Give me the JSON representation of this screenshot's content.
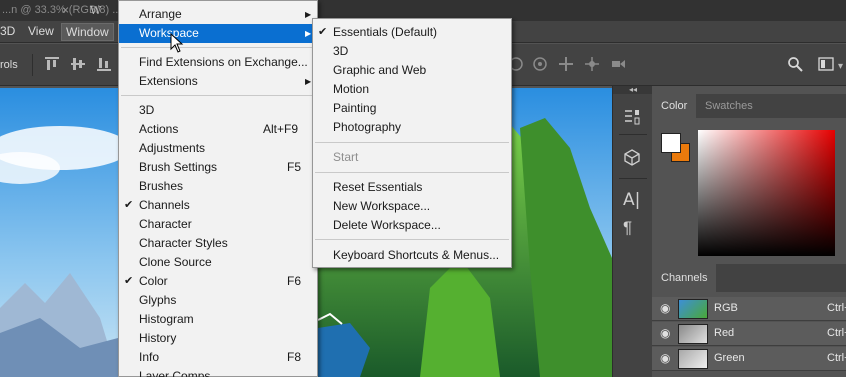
{
  "title_strip": {
    "tab_label": "...n @ 33.3% (RGB/8) ...",
    "tab_close": "×",
    "doc_tab_glyph": "W"
  },
  "menubar": {
    "items": [
      {
        "label": "3D"
      },
      {
        "label": "View"
      },
      {
        "label": "Window"
      }
    ]
  },
  "options_bar": {
    "label": "rols"
  },
  "color_panel": {
    "tabs": [
      "Color",
      "Swatches"
    ],
    "foreground": "#ffffff",
    "background": "#ea7a0c"
  },
  "channels_panel": {
    "tab": "Channels",
    "rows": [
      {
        "name": "RGB",
        "shortcut": "Ctrl+"
      },
      {
        "name": "Red",
        "shortcut": "Ctrl+"
      },
      {
        "name": "Green",
        "shortcut": "Ctrl+"
      }
    ]
  },
  "window_menu": {
    "items": [
      {
        "label": "Arrange",
        "submenu": true
      },
      {
        "label": "Workspace",
        "submenu": true,
        "highlighted": true
      },
      {
        "label": "Find Extensions on Exchange..."
      },
      {
        "label": "Extensions",
        "submenu": true
      },
      {
        "label": "3D"
      },
      {
        "label": "Actions",
        "shortcut": "Alt+F9"
      },
      {
        "label": "Adjustments"
      },
      {
        "label": "Brush Settings",
        "shortcut": "F5"
      },
      {
        "label": "Brushes"
      },
      {
        "label": "Channels",
        "checked": true
      },
      {
        "label": "Character"
      },
      {
        "label": "Character Styles"
      },
      {
        "label": "Clone Source"
      },
      {
        "label": "Color",
        "shortcut": "F6",
        "checked": true
      },
      {
        "label": "Glyphs"
      },
      {
        "label": "Histogram"
      },
      {
        "label": "History"
      },
      {
        "label": "Info",
        "shortcut": "F8"
      },
      {
        "label": "Layer Comps"
      }
    ]
  },
  "workspace_menu": {
    "items": [
      {
        "label": "Essentials (Default)",
        "checked": true
      },
      {
        "label": "3D"
      },
      {
        "label": "Graphic and Web"
      },
      {
        "label": "Motion"
      },
      {
        "label": "Painting"
      },
      {
        "label": "Photography"
      },
      {
        "label": "Start",
        "disabled": true
      },
      {
        "label": "Reset Essentials"
      },
      {
        "label": "New Workspace..."
      },
      {
        "label": "Delete Workspace..."
      },
      {
        "label": "Keyboard Shortcuts & Menus..."
      }
    ]
  },
  "glyphs": {
    "check": "✔",
    "arrow": "▶",
    "eye": "👁",
    "collapse": "◂◂"
  }
}
